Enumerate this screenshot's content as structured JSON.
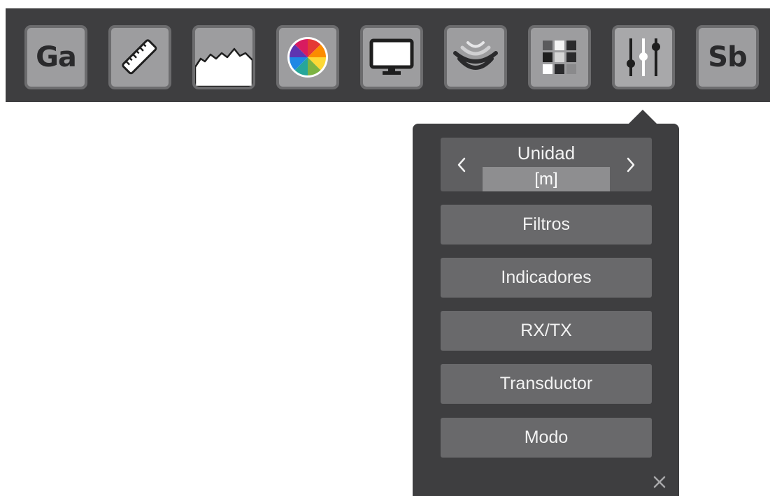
{
  "toolbar": {
    "buttons": [
      {
        "text": "Ga",
        "icon": "gain-text-icon"
      },
      {
        "icon": "ruler-icon"
      },
      {
        "icon": "waveform-icon"
      },
      {
        "icon": "color-wheel-icon"
      },
      {
        "icon": "monitor-icon"
      },
      {
        "icon": "sonar-waves-icon"
      },
      {
        "icon": "palette-grid-icon"
      },
      {
        "icon": "sliders-icon",
        "active": true
      },
      {
        "text": "Sb",
        "icon": "sb-text-icon"
      }
    ]
  },
  "popup": {
    "unit": {
      "title": "Unidad",
      "value": "[m]"
    },
    "items": [
      "Filtros",
      "Indicadores",
      "RX/TX",
      "Transductor",
      "Modo"
    ],
    "close_symbol": "✕"
  },
  "colors": {
    "toolbar_bg": "#3e3e40",
    "button_face": "#9d9d9f",
    "menu_button": "#69696b",
    "unit_value_bg": "#8e8e90"
  }
}
